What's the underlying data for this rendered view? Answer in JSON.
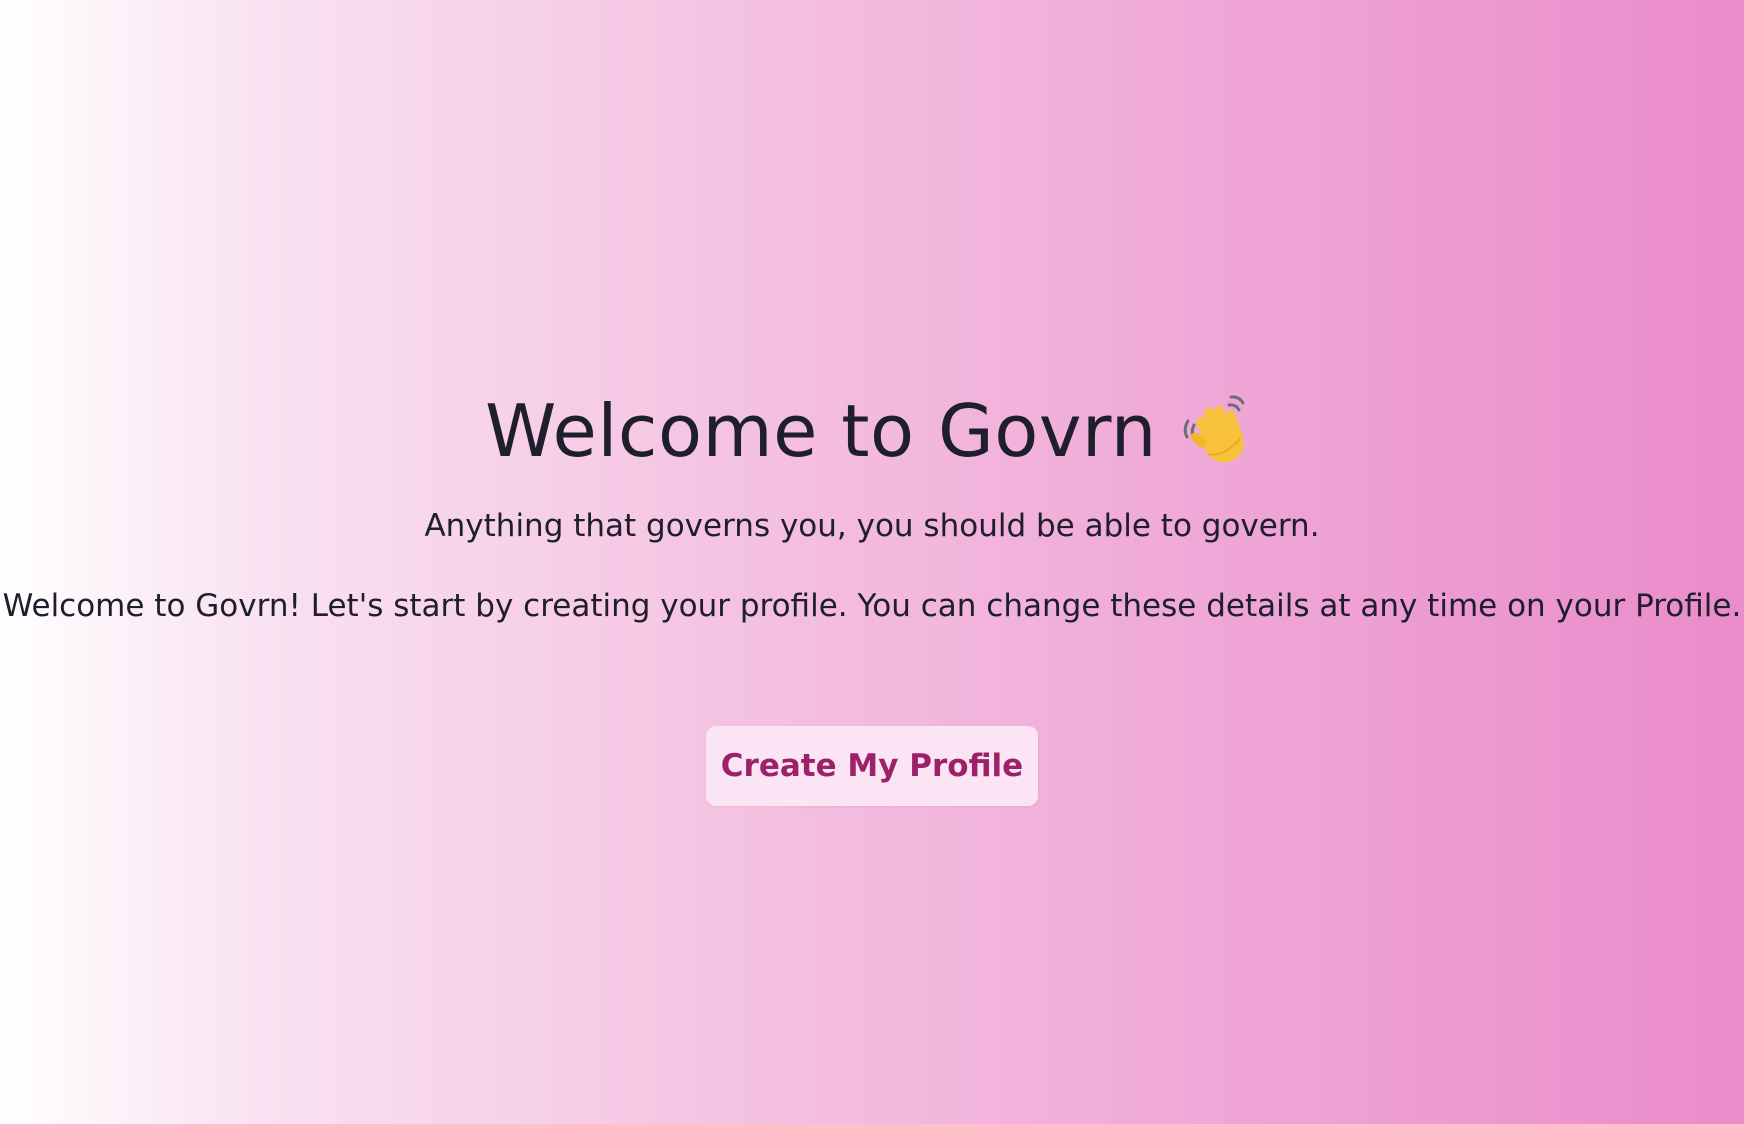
{
  "welcome": {
    "title": "Welcome to Govrn",
    "title_icon": "waving-hand-icon",
    "tagline": "Anything that governs you, you should be able to govern.",
    "intro": "Welcome to Govrn! Let's start by creating your profile. You can change these details at any time on your Profile.",
    "cta_label": "Create My Profile"
  },
  "colors": {
    "background_gradient": [
      "#ffffff",
      "#f9e2f1",
      "#f4bfe0",
      "#eea2d5",
      "#ea8bcb"
    ],
    "text": "#1e1e2c",
    "button_background": "#fbe4f4",
    "button_text": "#9d2169"
  }
}
